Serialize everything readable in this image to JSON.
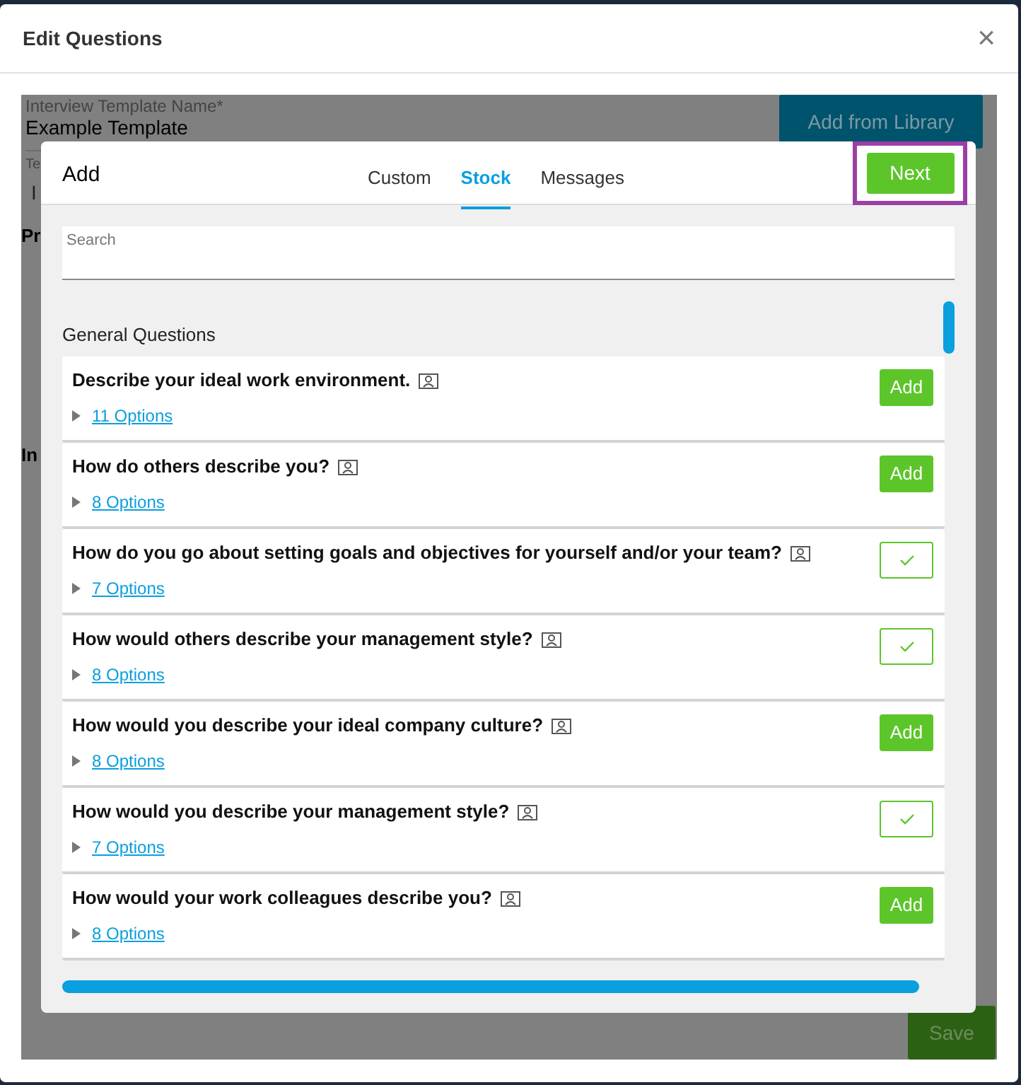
{
  "dialog": {
    "title": "Edit Questions",
    "close": "×"
  },
  "background": {
    "template_label": "Interview Template Name*",
    "template_value": "Example Template",
    "library_button": "Add from Library",
    "fragments": [
      "Te",
      "I",
      "Pr",
      "In"
    ],
    "save_button": "Save"
  },
  "add_modal": {
    "title": "Add",
    "tabs": [
      {
        "label": "Custom",
        "selected": false
      },
      {
        "label": "Stock",
        "selected": true
      },
      {
        "label": "Messages",
        "selected": false
      }
    ],
    "next_button": "Next",
    "next_highlighted": true,
    "search": {
      "placeholder": "Search"
    },
    "section": "General Questions",
    "questions": [
      {
        "text": "Describe your ideal work environment.",
        "options": "11 Options",
        "added": false,
        "add_label": "Add"
      },
      {
        "text": "How do others describe you?",
        "options": "8 Options",
        "added": false,
        "add_label": "Add"
      },
      {
        "text": "How do you go about setting goals and objectives for yourself and/or your team?",
        "options": "7 Options",
        "added": true
      },
      {
        "text": "How would others describe your management style?",
        "options": "8 Options",
        "added": true
      },
      {
        "text": "How would you describe your ideal company culture?",
        "options": "8 Options",
        "added": false,
        "add_label": "Add"
      },
      {
        "text": "How would you describe your management style?",
        "options": "7 Options",
        "added": true
      },
      {
        "text": "How would your work colleagues describe you?",
        "options": "8 Options",
        "added": false,
        "add_label": "Add"
      }
    ]
  }
}
